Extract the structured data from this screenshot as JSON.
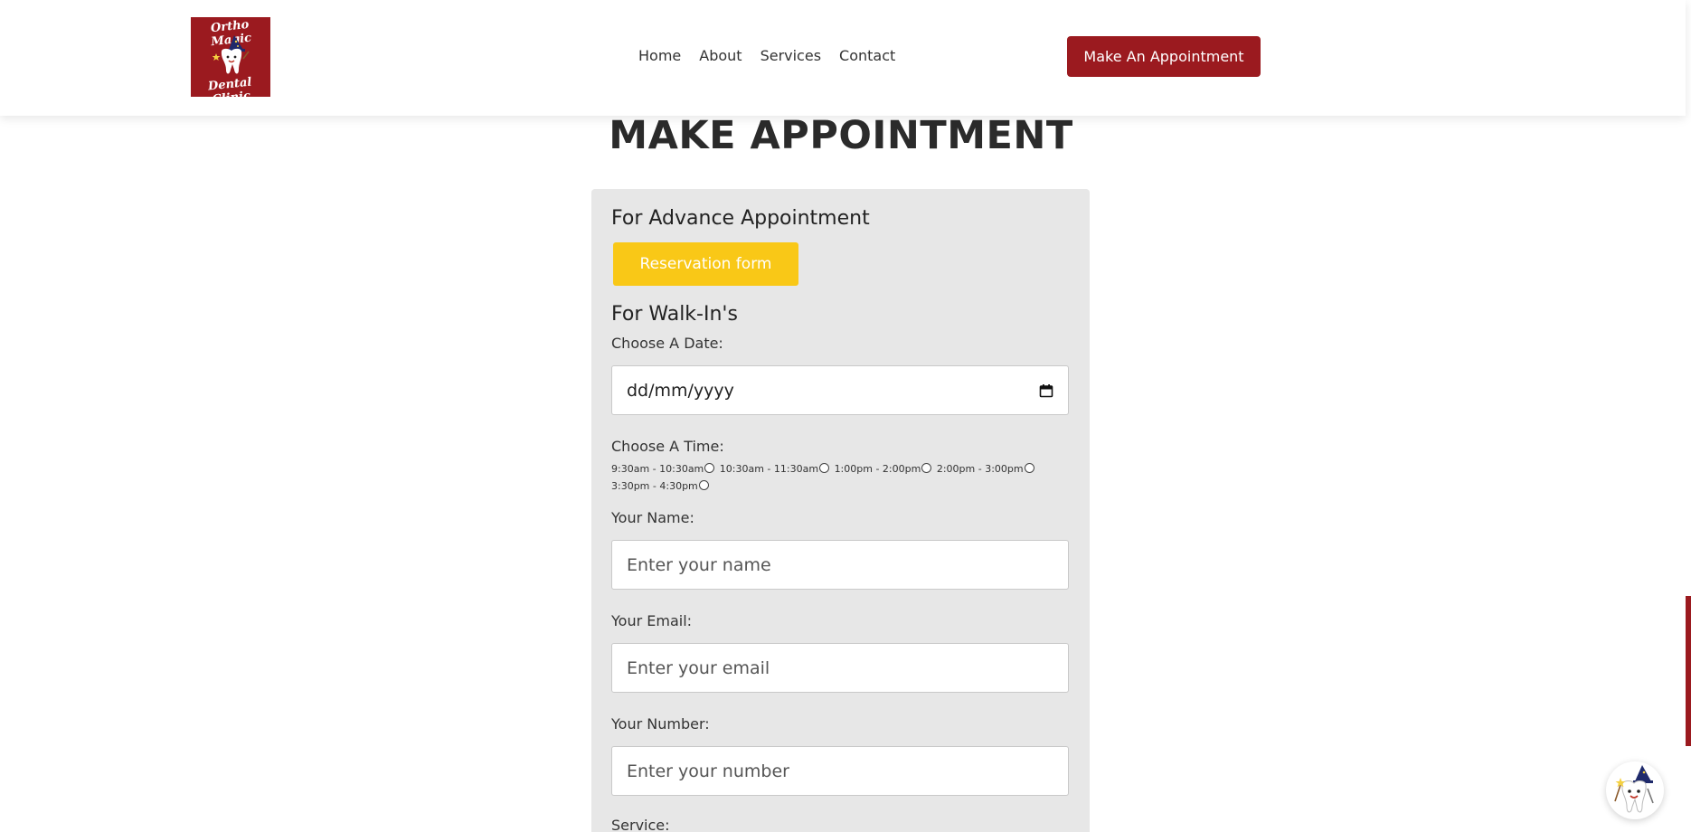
{
  "header": {
    "logo": {
      "line1": "Ortho Magic",
      "line2": "Dental Clinic",
      "icon": "wizard-tooth-logo",
      "bg_color": "#9b1a1f"
    },
    "nav": [
      "Home",
      "About",
      "Services",
      "Contact"
    ],
    "cta_label": "Make An Appointment",
    "cta_color": "#9b1a1f"
  },
  "main": {
    "title": "MAKE APPOINTMENT"
  },
  "form": {
    "advance_title": "For Advance Appointment",
    "reservation_button": "Reservation form",
    "reservation_color": "#f9c817",
    "walkin_title": "For Walk-In's",
    "date_label": "Choose A Date:",
    "date_placeholder": "dd/mm/yyyy",
    "time_label": "Choose A Time:",
    "time_slots": [
      "9:30am - 10:30am",
      "10:30am - 11:30am",
      "1:00pm - 2:00pm",
      "2:00pm - 3:00pm",
      "3:30pm - 4:30pm"
    ],
    "name_label": "Your Name:",
    "name_placeholder": "Enter your name",
    "email_label": "Your Email:",
    "email_placeholder": "Enter your email",
    "number_label": "Your Number:",
    "number_placeholder": "Enter your number",
    "service_label": "Service:"
  },
  "widgets": {
    "chat_icon": "wizard-tooth-mascot-icon"
  }
}
